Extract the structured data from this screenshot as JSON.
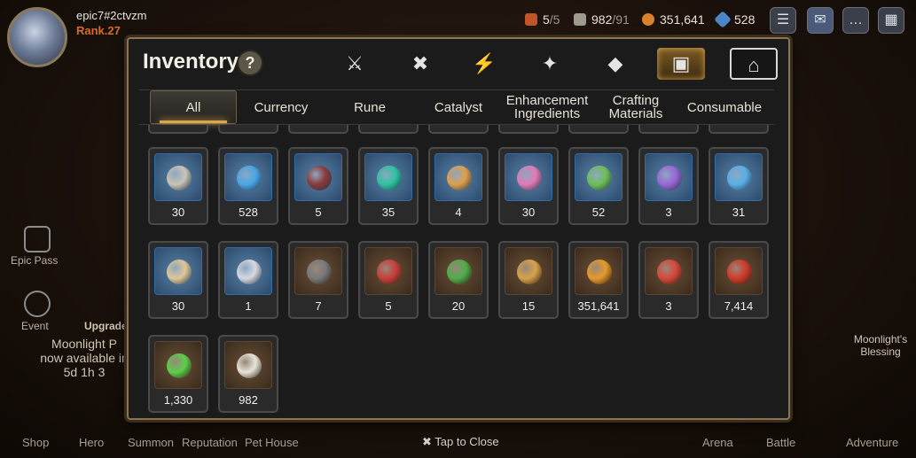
{
  "player": {
    "name": "epic7#2ctvzm",
    "rank": "Rank.27"
  },
  "resources": [
    {
      "name": "energy-icon",
      "value": "5",
      "max": "/5"
    },
    {
      "name": "stamina-icon",
      "value": "982",
      "max": "/91"
    },
    {
      "name": "gold-icon",
      "value": "351,641",
      "max": ""
    },
    {
      "name": "skystone-icon",
      "value": "528",
      "max": ""
    }
  ],
  "side": {
    "epic_pass": "Epic Pass",
    "event": "Event",
    "upgrade": "Upgrade",
    "moonlight_blessing": "Moonlight's Blessing"
  },
  "notice": {
    "line1": "Moonlight P",
    "line2": "now available in",
    "line3": "5d 1h 3"
  },
  "bottom_nav": [
    "Shop",
    "Hero",
    "Summon",
    "Reputation",
    "Pet House",
    "Arena",
    "Battle",
    "Adventure"
  ],
  "inventory": {
    "title": "Inventory",
    "help": "?",
    "filter_tabs": [
      {
        "name": "equipment-filter-icon",
        "glyph": "⚔"
      },
      {
        "name": "artifact-filter-icon",
        "glyph": "✖"
      },
      {
        "name": "lightning-filter-icon",
        "glyph": "⚡"
      },
      {
        "name": "catalyst-filter-icon",
        "glyph": "✦"
      },
      {
        "name": "dice-filter-icon",
        "glyph": "◆"
      },
      {
        "name": "item-bag-filter-icon",
        "glyph": "▣"
      },
      {
        "name": "storage-filter-icon",
        "glyph": "⌂"
      }
    ],
    "categories": [
      "All",
      "Currency",
      "Rune",
      "Catalyst",
      "Enhancement Ingredients",
      "Crafting Materials",
      "Consumable"
    ],
    "active_category": "All",
    "items": [
      {
        "name": "silver-coin-icon",
        "count": "30",
        "color": "#c9c4b8",
        "frame": "blue"
      },
      {
        "name": "blue-crystal-icon",
        "count": "528",
        "color": "#4aa6e8",
        "frame": "blue"
      },
      {
        "name": "crossbow-icon",
        "count": "5",
        "color": "#8a3a3a",
        "frame": "blue"
      },
      {
        "name": "green-crystal-icon",
        "count": "35",
        "color": "#2ec4a0",
        "frame": "blue"
      },
      {
        "name": "compass-star-icon",
        "count": "4",
        "color": "#e0a04a",
        "frame": "blue"
      },
      {
        "name": "pink-crystal-cluster-icon",
        "count": "30",
        "color": "#e27ab8",
        "frame": "blue"
      },
      {
        "name": "green-leaf-icon",
        "count": "52",
        "color": "#6fbf5a",
        "frame": "blue"
      },
      {
        "name": "purple-rune-icon",
        "count": "3",
        "color": "#9a66d8",
        "frame": "blue"
      },
      {
        "name": "blue-rune-icon",
        "count": "31",
        "color": "#5ab0e8",
        "frame": "blue"
      },
      {
        "name": "treasure-map-icon",
        "count": "30",
        "color": "#e0c898",
        "frame": "blue"
      },
      {
        "name": "scroll-ribbon-icon",
        "count": "1",
        "color": "#d8d8e0",
        "frame": "blue"
      },
      {
        "name": "stone-tablet-icon",
        "count": "7",
        "color": "#7a7a7a",
        "frame": "brown"
      },
      {
        "name": "red-banner-icon",
        "count": "5",
        "color": "#c8403a",
        "frame": "brown"
      },
      {
        "name": "four-leaf-clover-icon",
        "count": "20",
        "color": "#4fae4a",
        "frame": "brown"
      },
      {
        "name": "gold-crest-icon",
        "count": "15",
        "color": "#d8a24a",
        "frame": "brown"
      },
      {
        "name": "gold-coin-icon",
        "count": "351,641",
        "color": "#e89a2a",
        "frame": "brown"
      },
      {
        "name": "red-seal-icon",
        "count": "3",
        "color": "#d8483a",
        "frame": "brown"
      },
      {
        "name": "red-mask-icon",
        "count": "7,414",
        "color": "#d23a2a",
        "frame": "brown"
      },
      {
        "name": "green-heart-icon",
        "count": "1,330",
        "color": "#5ccf4a",
        "frame": "brown"
      },
      {
        "name": "knight-chess-icon",
        "count": "982",
        "color": "#e8e4d8",
        "frame": "brown"
      }
    ]
  },
  "close_label": "Tap to Close"
}
